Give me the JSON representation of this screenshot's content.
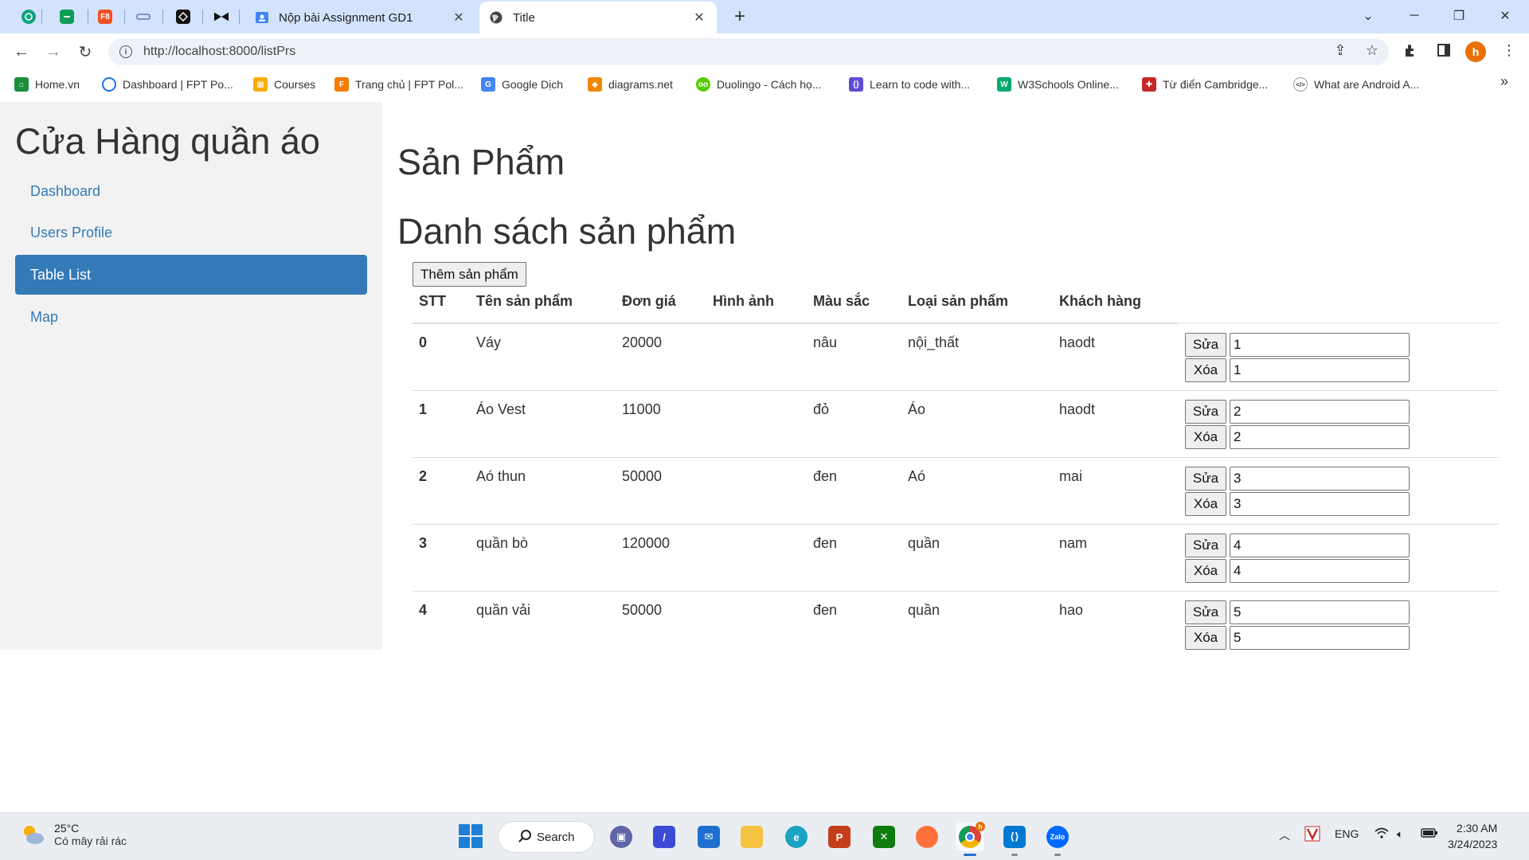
{
  "browser": {
    "tabs": [
      {
        "title": "Nộp bài Assignment GD1"
      },
      {
        "title": "Title"
      }
    ],
    "url": "http://localhost:8000/listPrs",
    "profile_initial": "h",
    "bookmarks": [
      {
        "label": "Home.vn",
        "icon": "home-vn-icon"
      },
      {
        "label": "Dashboard | FPT Po...",
        "icon": "fpt-dashboard-icon"
      },
      {
        "label": "Courses",
        "icon": "courses-icon"
      },
      {
        "label": "Trang chủ | FPT Pol...",
        "icon": "fpt-home-icon"
      },
      {
        "label": "Google Dịch",
        "icon": "google-translate-icon"
      },
      {
        "label": "diagrams.net",
        "icon": "diagrams-icon"
      },
      {
        "label": "Duolingo - Cách họ...",
        "icon": "duolingo-icon"
      },
      {
        "label": "Learn to code with...",
        "icon": "code-icon"
      },
      {
        "label": "W3Schools Online...",
        "icon": "w3schools-icon"
      },
      {
        "label": "Từ điển Cambridge...",
        "icon": "cambridge-icon"
      },
      {
        "label": "What are Android A...",
        "icon": "android-icon"
      }
    ],
    "mini_tab_labels": {
      "f8": "F8"
    }
  },
  "sidebar": {
    "title": "Cửa Hàng quần áo",
    "items": [
      {
        "label": "Dashboard",
        "active": false
      },
      {
        "label": "Users Profile",
        "active": false
      },
      {
        "label": "Table List",
        "active": true
      },
      {
        "label": "Map",
        "active": false
      }
    ]
  },
  "main": {
    "heading": "Sản Phẩm",
    "list_heading": "Danh sách sản phẩm",
    "add_button": "Thêm sản phẩm",
    "columns": [
      "STT",
      "Tên sản phẩm",
      "Đơn giá",
      "Hình ảnh",
      "Màu sắc",
      "Loại sản phẩm",
      "Khách hàng"
    ],
    "edit_label": "Sửa",
    "delete_label": "Xóa",
    "rows": [
      {
        "stt": "0",
        "name": "Váy",
        "price": "20000",
        "image": "",
        "color": "nâu",
        "type": "nội_thất",
        "customer": "haodt",
        "id": "1"
      },
      {
        "stt": "1",
        "name": "Áo Vest",
        "price": "11000",
        "image": "",
        "color": "đỏ",
        "type": "Áo",
        "customer": "haodt",
        "id": "2"
      },
      {
        "stt": "2",
        "name": "Aó thun",
        "price": "50000",
        "image": "",
        "color": "đen",
        "type": "Aó",
        "customer": "mai",
        "id": "3"
      },
      {
        "stt": "3",
        "name": "quần bò",
        "price": "120000",
        "image": "",
        "color": "đen",
        "type": "quần",
        "customer": "nam",
        "id": "4"
      },
      {
        "stt": "4",
        "name": "quần vải",
        "price": "50000",
        "image": "",
        "color": "đen",
        "type": "quần",
        "customer": "hao",
        "id": "5"
      }
    ]
  },
  "taskbar": {
    "temperature": "25°C",
    "weather": "Có mây rải rác",
    "search_label": "Search",
    "language": "ENG",
    "time": "2:30 AM",
    "date": "3/24/2023",
    "apps": [
      "teams-icon",
      "azure-icon",
      "mail-icon",
      "file-explorer-icon",
      "edge-icon",
      "powerpoint-icon",
      "xbox-icon",
      "firefox-icon",
      "chrome-icon",
      "vscode-icon",
      "zalo-icon"
    ],
    "zalo_label": "Zalo",
    "chrome_badge": "h"
  },
  "colors": {
    "accent": "#337ab7",
    "sidebar_bg": "#f2f2f2",
    "tabstrip_bg": "#d3e3fd"
  }
}
